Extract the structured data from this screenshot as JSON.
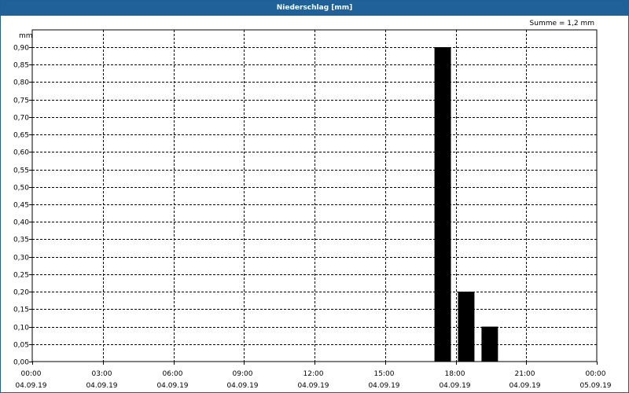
{
  "window": {
    "title": "Niederschlag [mm]"
  },
  "summary": {
    "text": "Summe = 1,2 mm"
  },
  "colors": {
    "title_bar": "#1f6198",
    "bars": "#000000",
    "grid": "#000000"
  },
  "chart_data": {
    "type": "bar",
    "title": "Niederschlag [mm]",
    "ylabel": "mm",
    "xlabel": "",
    "ylim": [
      0,
      0.9
    ],
    "grid": true,
    "x_range": [
      "04.09.19 00:00",
      "05.09.19 00:00"
    ],
    "y_ticks": [
      "0,00",
      "0,05",
      "0,10",
      "0,15",
      "0,20",
      "0,25",
      "0,30",
      "0,35",
      "0,40",
      "0,45",
      "0,50",
      "0,55",
      "0,60",
      "0,65",
      "0,70",
      "0,75",
      "0,80",
      "0,85",
      "0,90"
    ],
    "x_ticks": [
      {
        "time": "00:00",
        "date": "04.09.19"
      },
      {
        "time": "03:00",
        "date": "04.09.19"
      },
      {
        "time": "06:00",
        "date": "04.09.19"
      },
      {
        "time": "09:00",
        "date": "04.09.19"
      },
      {
        "time": "12:00",
        "date": "04.09.19"
      },
      {
        "time": "15:00",
        "date": "04.09.19"
      },
      {
        "time": "18:00",
        "date": "04.09.19"
      },
      {
        "time": "21:00",
        "date": "04.09.19"
      },
      {
        "time": "00:00",
        "date": "05.09.19"
      }
    ],
    "bars": [
      {
        "start": "04.09.19 17:00",
        "end": "04.09.19 18:00",
        "value": 0.9
      },
      {
        "start": "04.09.19 18:00",
        "end": "04.09.19 19:00",
        "value": 0.2
      },
      {
        "start": "04.09.19 19:00",
        "end": "04.09.19 20:00",
        "value": 0.1
      }
    ]
  }
}
